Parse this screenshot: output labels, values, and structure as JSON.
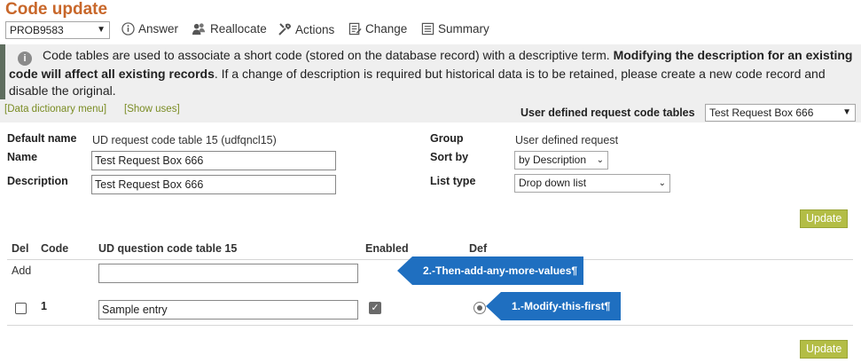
{
  "page": {
    "title": "Code update",
    "problem_select": "PROB9583"
  },
  "toolbar": {
    "answer": "Answer",
    "reallocate": "Reallocate",
    "actions": "Actions",
    "change": "Change",
    "summary": "Summary"
  },
  "info": {
    "text1": "Code tables are used to associate a short code (stored on the database record) with a descriptive term. ",
    "bold": "Modifying the description for an existing code will affect all existing records",
    "text2": ". If a change of description is required but historical data is to be retained, please create a new code record and disable the original."
  },
  "links": {
    "data_dictionary": "[Data dictionary menu]",
    "show_uses": "[Show uses]"
  },
  "udr_tables": {
    "label": "User defined request code tables",
    "selected": "Test Request Box 666"
  },
  "form": {
    "default_name_label": "Default name",
    "default_name_value": "UD request code table 15 (udfqncl15)",
    "name_label": "Name",
    "name_value": "Test Request Box 666",
    "description_label": "Description",
    "description_value": "Test Request Box 666",
    "group_label": "Group",
    "group_value": "User defined request",
    "sort_by_label": "Sort by",
    "sort_by_value": "by Description",
    "list_type_label": "List type",
    "list_type_value": "Drop down list",
    "update_label": "Update"
  },
  "table": {
    "headers": {
      "del": "Del",
      "code": "Code",
      "question": "UD question code table 15",
      "enabled": "Enabled",
      "def": "Def"
    },
    "add_label": "Add",
    "add_value": "",
    "rows": [
      {
        "code": "1",
        "value": "Sample entry",
        "enabled": true,
        "default": true,
        "del": false
      }
    ],
    "update_label": "Update"
  },
  "callouts": {
    "then_add": "2.-Then-add-any-more-values¶",
    "modify_first": "1.-Modify-this-first¶"
  },
  "colors": {
    "title": "#c8672a",
    "button": "#b3bd45",
    "callout": "#1f6fc0",
    "link": "#7a8c23"
  }
}
